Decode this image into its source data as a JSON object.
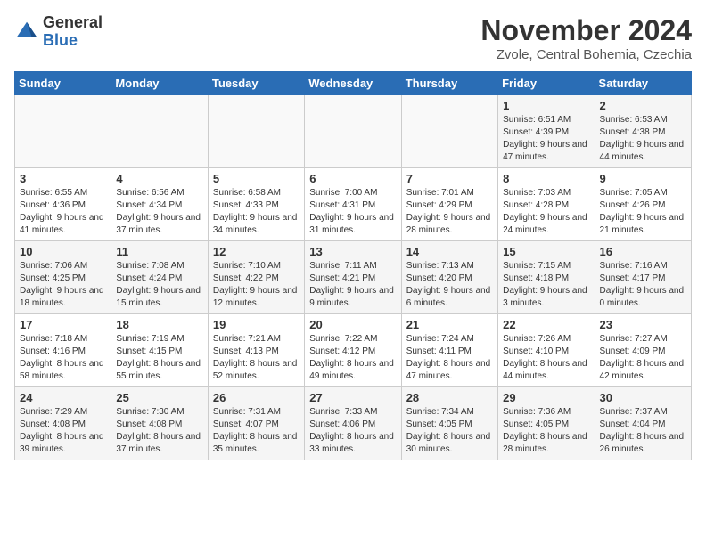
{
  "header": {
    "logo_general": "General",
    "logo_blue": "Blue",
    "month_title": "November 2024",
    "location": "Zvole, Central Bohemia, Czechia"
  },
  "days_of_week": [
    "Sunday",
    "Monday",
    "Tuesday",
    "Wednesday",
    "Thursday",
    "Friday",
    "Saturday"
  ],
  "weeks": [
    [
      {
        "day": "",
        "info": ""
      },
      {
        "day": "",
        "info": ""
      },
      {
        "day": "",
        "info": ""
      },
      {
        "day": "",
        "info": ""
      },
      {
        "day": "",
        "info": ""
      },
      {
        "day": "1",
        "info": "Sunrise: 6:51 AM\nSunset: 4:39 PM\nDaylight: 9 hours and 47 minutes."
      },
      {
        "day": "2",
        "info": "Sunrise: 6:53 AM\nSunset: 4:38 PM\nDaylight: 9 hours and 44 minutes."
      }
    ],
    [
      {
        "day": "3",
        "info": "Sunrise: 6:55 AM\nSunset: 4:36 PM\nDaylight: 9 hours and 41 minutes."
      },
      {
        "day": "4",
        "info": "Sunrise: 6:56 AM\nSunset: 4:34 PM\nDaylight: 9 hours and 37 minutes."
      },
      {
        "day": "5",
        "info": "Sunrise: 6:58 AM\nSunset: 4:33 PM\nDaylight: 9 hours and 34 minutes."
      },
      {
        "day": "6",
        "info": "Sunrise: 7:00 AM\nSunset: 4:31 PM\nDaylight: 9 hours and 31 minutes."
      },
      {
        "day": "7",
        "info": "Sunrise: 7:01 AM\nSunset: 4:29 PM\nDaylight: 9 hours and 28 minutes."
      },
      {
        "day": "8",
        "info": "Sunrise: 7:03 AM\nSunset: 4:28 PM\nDaylight: 9 hours and 24 minutes."
      },
      {
        "day": "9",
        "info": "Sunrise: 7:05 AM\nSunset: 4:26 PM\nDaylight: 9 hours and 21 minutes."
      }
    ],
    [
      {
        "day": "10",
        "info": "Sunrise: 7:06 AM\nSunset: 4:25 PM\nDaylight: 9 hours and 18 minutes."
      },
      {
        "day": "11",
        "info": "Sunrise: 7:08 AM\nSunset: 4:24 PM\nDaylight: 9 hours and 15 minutes."
      },
      {
        "day": "12",
        "info": "Sunrise: 7:10 AM\nSunset: 4:22 PM\nDaylight: 9 hours and 12 minutes."
      },
      {
        "day": "13",
        "info": "Sunrise: 7:11 AM\nSunset: 4:21 PM\nDaylight: 9 hours and 9 minutes."
      },
      {
        "day": "14",
        "info": "Sunrise: 7:13 AM\nSunset: 4:20 PM\nDaylight: 9 hours and 6 minutes."
      },
      {
        "day": "15",
        "info": "Sunrise: 7:15 AM\nSunset: 4:18 PM\nDaylight: 9 hours and 3 minutes."
      },
      {
        "day": "16",
        "info": "Sunrise: 7:16 AM\nSunset: 4:17 PM\nDaylight: 9 hours and 0 minutes."
      }
    ],
    [
      {
        "day": "17",
        "info": "Sunrise: 7:18 AM\nSunset: 4:16 PM\nDaylight: 8 hours and 58 minutes."
      },
      {
        "day": "18",
        "info": "Sunrise: 7:19 AM\nSunset: 4:15 PM\nDaylight: 8 hours and 55 minutes."
      },
      {
        "day": "19",
        "info": "Sunrise: 7:21 AM\nSunset: 4:13 PM\nDaylight: 8 hours and 52 minutes."
      },
      {
        "day": "20",
        "info": "Sunrise: 7:22 AM\nSunset: 4:12 PM\nDaylight: 8 hours and 49 minutes."
      },
      {
        "day": "21",
        "info": "Sunrise: 7:24 AM\nSunset: 4:11 PM\nDaylight: 8 hours and 47 minutes."
      },
      {
        "day": "22",
        "info": "Sunrise: 7:26 AM\nSunset: 4:10 PM\nDaylight: 8 hours and 44 minutes."
      },
      {
        "day": "23",
        "info": "Sunrise: 7:27 AM\nSunset: 4:09 PM\nDaylight: 8 hours and 42 minutes."
      }
    ],
    [
      {
        "day": "24",
        "info": "Sunrise: 7:29 AM\nSunset: 4:08 PM\nDaylight: 8 hours and 39 minutes."
      },
      {
        "day": "25",
        "info": "Sunrise: 7:30 AM\nSunset: 4:08 PM\nDaylight: 8 hours and 37 minutes."
      },
      {
        "day": "26",
        "info": "Sunrise: 7:31 AM\nSunset: 4:07 PM\nDaylight: 8 hours and 35 minutes."
      },
      {
        "day": "27",
        "info": "Sunrise: 7:33 AM\nSunset: 4:06 PM\nDaylight: 8 hours and 33 minutes."
      },
      {
        "day": "28",
        "info": "Sunrise: 7:34 AM\nSunset: 4:05 PM\nDaylight: 8 hours and 30 minutes."
      },
      {
        "day": "29",
        "info": "Sunrise: 7:36 AM\nSunset: 4:05 PM\nDaylight: 8 hours and 28 minutes."
      },
      {
        "day": "30",
        "info": "Sunrise: 7:37 AM\nSunset: 4:04 PM\nDaylight: 8 hours and 26 minutes."
      }
    ]
  ]
}
